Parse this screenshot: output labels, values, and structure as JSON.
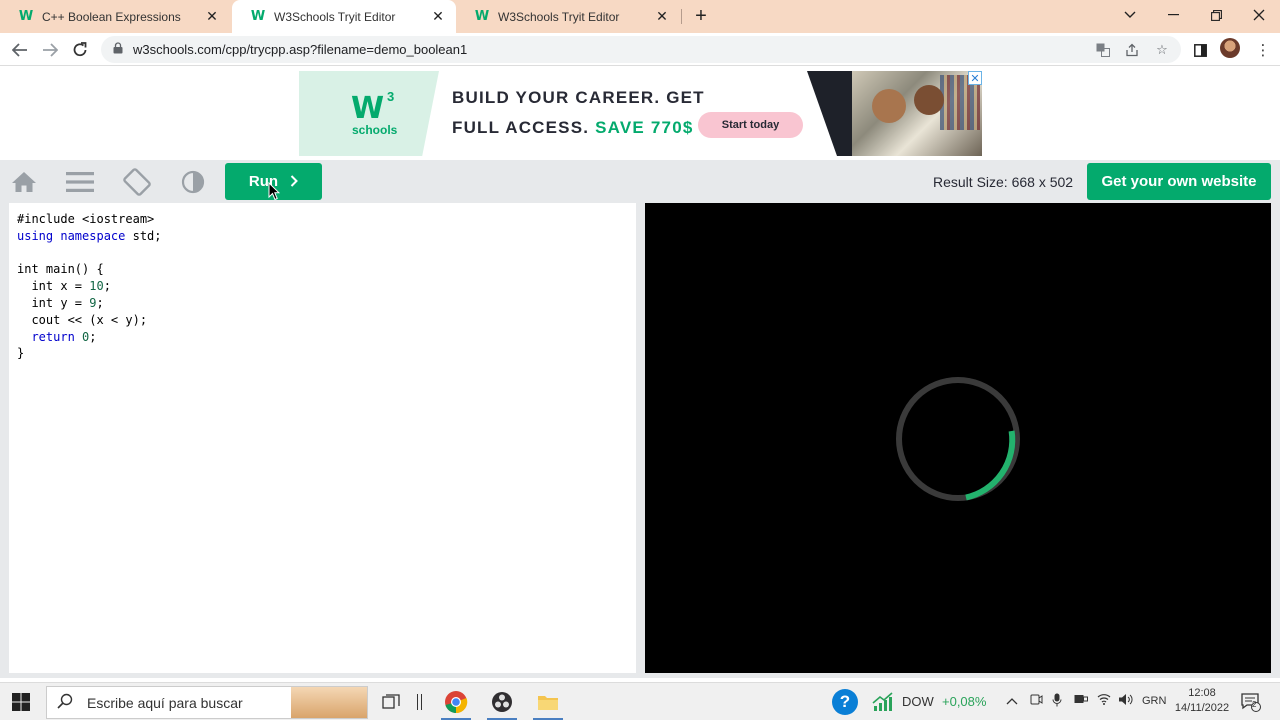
{
  "browser": {
    "tabs": [
      {
        "title": "C++ Boolean Expressions",
        "active": false
      },
      {
        "title": "W3Schools Tryit Editor",
        "active": true
      },
      {
        "title": "W3Schools Tryit Editor",
        "active": false
      }
    ],
    "url": "w3schools.com/cpp/trycpp.asp?filename=demo_boolean1"
  },
  "ad": {
    "logo_mark": "W",
    "logo_sup": "3",
    "logo_text": "schools",
    "line1": "BUILD YOUR CAREER. GET",
    "line2_prefix": "FULL ACCESS.",
    "line2_highlight": "SAVE 770$",
    "cta": "Start today",
    "close": "✕"
  },
  "editor": {
    "run_label": "Run",
    "result_size": "Result Size: 668 x 502",
    "get_website": "Get your own website",
    "code_lines": [
      "#include <iostream>",
      "using namespace std;",
      "",
      "int main() {",
      "  int x = 10;",
      "  int y = 9;",
      "  cout << (x < y);",
      "  return 0;",
      "}"
    ]
  },
  "taskbar": {
    "search_placeholder": "Escribe aquí para buscar",
    "stock_name": "DOW",
    "stock_change": "+0,08%",
    "language": "GRN",
    "time": "12:08",
    "date": "14/11/2022",
    "notification_count": "2"
  },
  "colors": {
    "accent": "#04aa6d",
    "tabstrip": "#f7d9c4",
    "result_bg": "#000000"
  }
}
